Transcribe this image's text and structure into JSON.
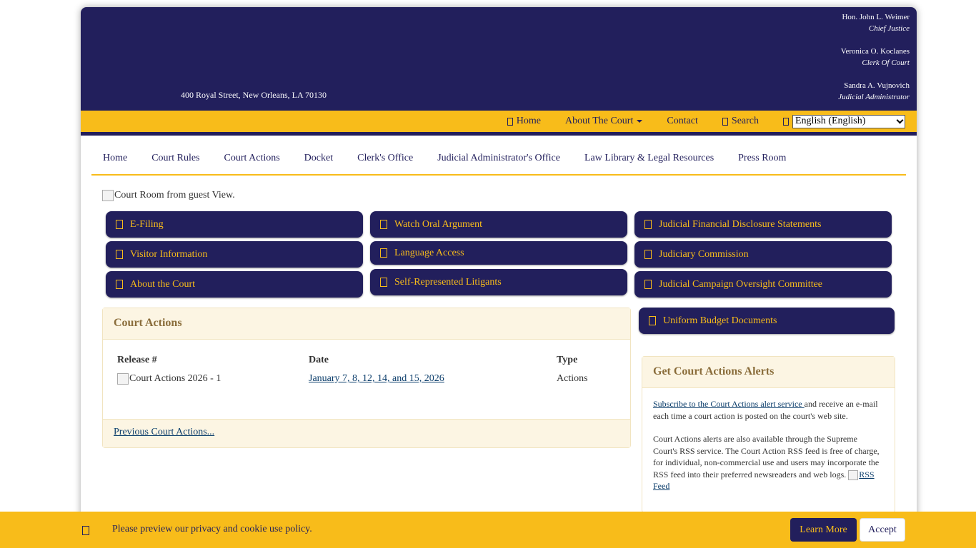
{
  "header": {
    "address": "400 Royal Street, New Orleans, LA 70130",
    "officials": [
      {
        "name": "Hon. John L. Weimer",
        "role": "Chief Justice"
      },
      {
        "name": "Veronica O. Koclanes",
        "role": "Clerk Of Court"
      },
      {
        "name": "Sandra A. Vujnovich",
        "role": "Judicial Administrator"
      }
    ]
  },
  "topnav": {
    "home": "Home",
    "about": "About The Court",
    "contact": "Contact",
    "search": "Search",
    "language": "English (English)"
  },
  "mainnav": [
    "Home",
    "Court Rules",
    "Court Actions",
    "Docket",
    "Clerk's Office",
    "Judicial Administrator's Office",
    "Law Library & Legal Resources",
    "Press Room"
  ],
  "banner_alt": "Court Room from guest View.",
  "quicklinks": {
    "efiling": "E-Filing",
    "oral_argument": "Watch Oral Argument",
    "disclosure": "Judicial Financial Disclosure Statements",
    "visitor": "Visitor Information",
    "language_access": "Language Access",
    "judiciary_commission": "Judiciary Commission",
    "about_court": "About the Court",
    "self_represented": "Self-Represented Litigants",
    "campaign_oversight": "Judicial Campaign Oversight Committee",
    "budget": "Uniform Budget Documents"
  },
  "court_actions": {
    "title": "Court Actions",
    "headers": {
      "release": "Release #",
      "date": "Date",
      "type": "Type"
    },
    "row": {
      "release_img_alt": "Court Actions",
      "release_num": "2026 - 1",
      "date": "January 7, 8, 12, 14, and 15, 2026",
      "type": "Actions"
    },
    "previous": "Previous Court Actions..."
  },
  "alerts": {
    "title": "Get Court Actions Alerts",
    "subscribe_link": "Subscribe to the Court Actions alert service ",
    "subscribe_text": "and receive an e-mail each time a court action is posted on the court's web site.",
    "rss_text": "Court Actions alerts are also available through the Supreme Court's RSS service. The Court Action RSS feed is free of charge, for individual, non-commercial use and users may incorporate the RSS feed into their preferred newsreaders and web logs. ",
    "rss_link": "RSS Feed"
  },
  "cookie": {
    "text": "Please preview our privacy and cookie use policy.",
    "learn_more": "Learn More",
    "accept": "Accept"
  },
  "colors": {
    "navy": "#221f5c",
    "gold": "#f8bc1a",
    "panel_bg": "#fcf5e3"
  }
}
